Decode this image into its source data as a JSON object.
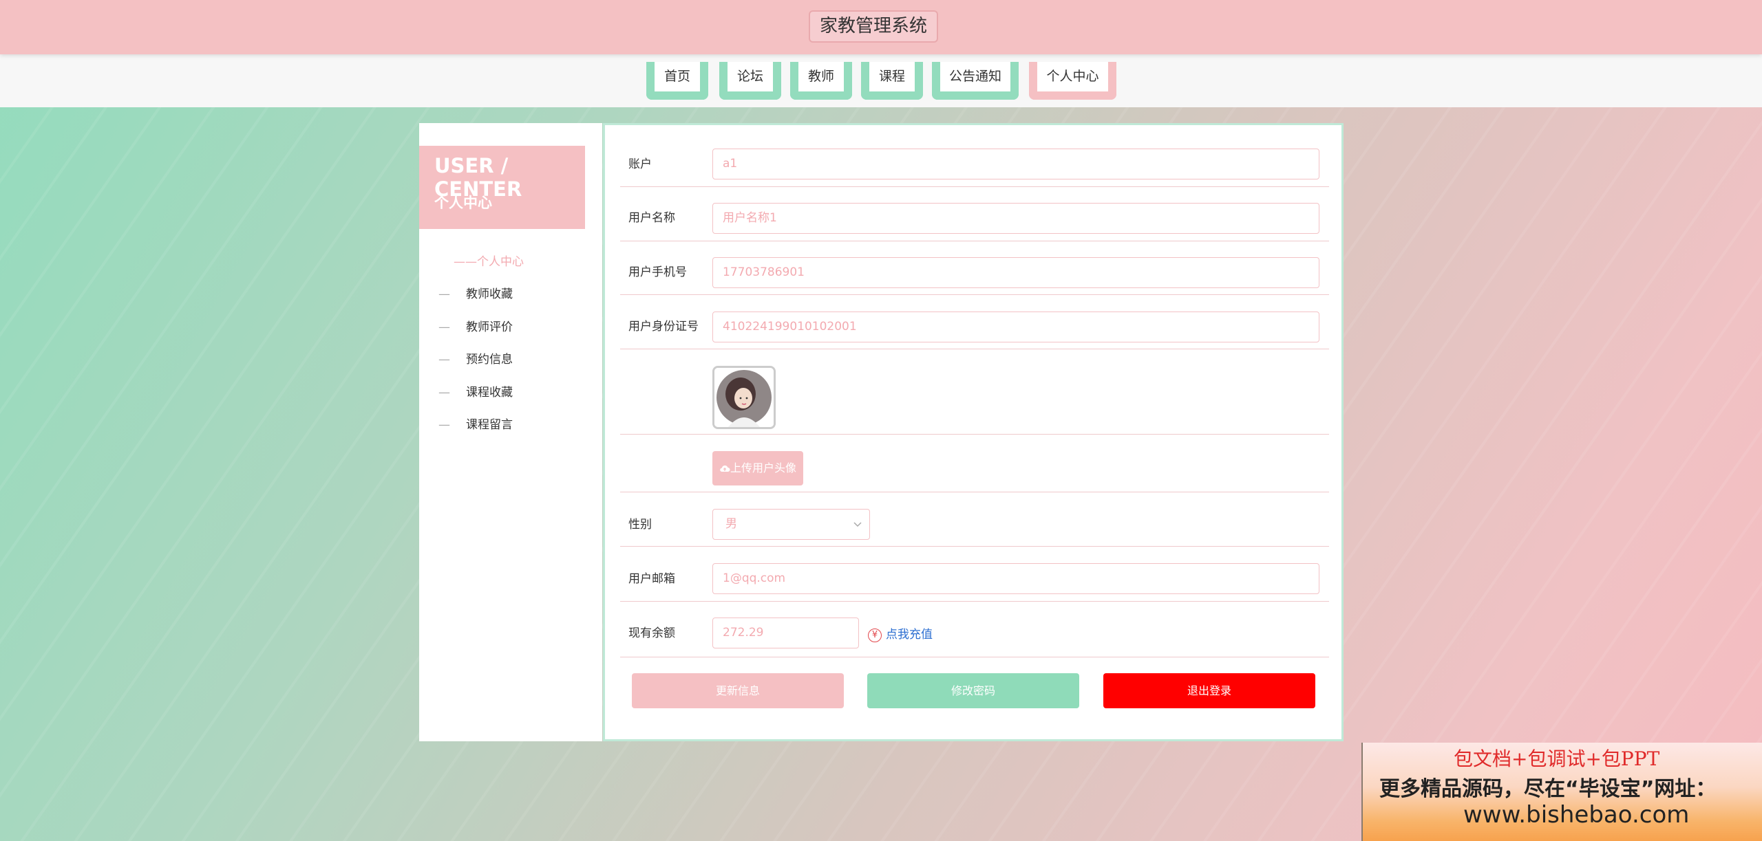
{
  "header": {
    "title": "家教管理系统"
  },
  "nav": {
    "items": [
      "首页",
      "论坛",
      "教师",
      "课程",
      "公告通知",
      "个人中心"
    ],
    "active": "个人中心"
  },
  "sidebar": {
    "title_en": "USER / CENTER",
    "title_cn": "个人中心",
    "menu_title": "个人中心",
    "items": [
      "教师收藏",
      "教师评价",
      "预约信息",
      "课程收藏",
      "课程留言"
    ],
    "dash": "—"
  },
  "form": {
    "account": {
      "label": "账户",
      "value": "a1"
    },
    "username": {
      "label": "用户名称",
      "value": "用户名称1"
    },
    "phone": {
      "label": "用户手机号",
      "value": "17703786901"
    },
    "id_card": {
      "label": "用户身份证号",
      "value": "410224199010102001"
    },
    "upload_label": "上传用户头像",
    "gender": {
      "label": "性别",
      "value": "男"
    },
    "email": {
      "label": "用户邮箱",
      "value": "1@qq.com"
    },
    "balance": {
      "label": "现有余额",
      "value": "272.29"
    },
    "recharge_label": "点我充值"
  },
  "actions": {
    "update": "更新信息",
    "change_password": "修改密码",
    "logout": "退出登录"
  },
  "promo": {
    "line1": "包文档+包调试+包PPT",
    "line2": "更多精品源码，尽在“毕设宝”网址：",
    "line3": "www.bishebao.com"
  },
  "colors": {
    "pink": "#f5c0c3",
    "mint": "#93dcbd",
    "danger": "#ff0000",
    "link": "#2d6fd1"
  },
  "icons": {
    "upload": "cloud-upload-icon",
    "yen": "yen-icon",
    "chevron": "chevron-down-icon"
  }
}
